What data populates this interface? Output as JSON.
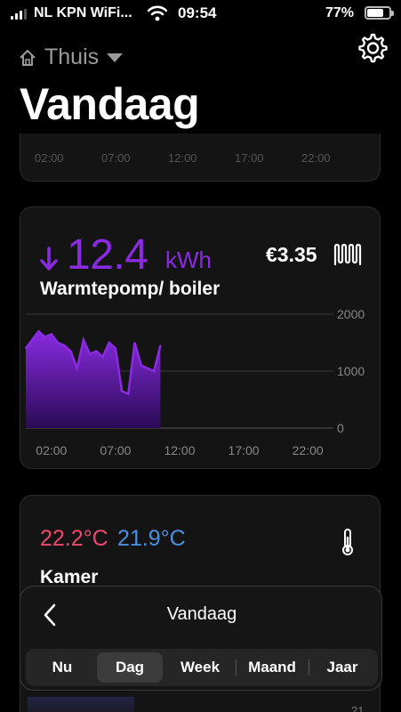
{
  "status_bar": {
    "carrier": "NL KPN WiFi...",
    "time": "09:54",
    "battery_percent": "77%",
    "battery_level": 0.77
  },
  "header": {
    "location": "Thuis",
    "title": "Vandaag"
  },
  "previous_card": {
    "tick_labels": [
      "02:00",
      "07:00",
      "12:00",
      "17:00",
      "22:00"
    ]
  },
  "energy_card": {
    "direction": "arrow-down-icon",
    "value": "12.4",
    "unit": "kWh",
    "cost": "€3.35",
    "label": "Warmtepomp/ boiler",
    "icon": "radiator-icon",
    "accent_color": "#8a2be2"
  },
  "chart_data": {
    "type": "area",
    "x": [
      "00:00",
      "01:00",
      "01:30",
      "02:00",
      "02:30",
      "03:00",
      "03:30",
      "04:00",
      "04:30",
      "05:00",
      "05:30",
      "06:00",
      "06:30",
      "07:00",
      "07:30",
      "08:00",
      "08:30",
      "09:00",
      "09:30",
      "10:00",
      "10:30"
    ],
    "values": [
      1400,
      1700,
      1600,
      1650,
      1500,
      1450,
      1350,
      1050,
      1550,
      1300,
      1350,
      1250,
      1500,
      1400,
      650,
      600,
      1500,
      1100,
      1050,
      1000,
      1450
    ],
    "xticks": [
      "02:00",
      "07:00",
      "12:00",
      "17:00",
      "22:00"
    ],
    "yticks": [
      "2000",
      "1000",
      "0"
    ],
    "ylim": [
      0,
      2000
    ],
    "grid": true,
    "fill_top": "#8a2be2",
    "fill_bottom": "#2a0a55"
  },
  "climate_card": {
    "temp_primary": "22.2°C",
    "temp_secondary": "21.9°C",
    "label": "Kamer",
    "icon": "thermometer-icon",
    "temp_primary_color": "#f0486e",
    "temp_secondary_color": "#4a90e2",
    "tick": "21"
  },
  "period_panel": {
    "title": "Vandaag",
    "tabs": [
      "Nu",
      "Dag",
      "Week",
      "Maand",
      "Jaar"
    ],
    "active_tab": "Dag"
  }
}
